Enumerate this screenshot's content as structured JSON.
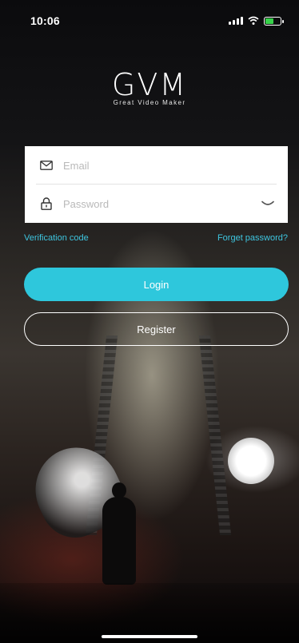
{
  "status_bar": {
    "time": "10:06"
  },
  "logo": {
    "title": "GVM",
    "tagline": "Great Video Maker"
  },
  "form": {
    "email_placeholder": "Email",
    "password_placeholder": "Password"
  },
  "links": {
    "verification": "Verification code",
    "forgot": "Forget password?"
  },
  "buttons": {
    "login": "Login",
    "register": "Register"
  },
  "colors": {
    "accent": "#2ec7dc",
    "link": "#3ec6e0",
    "battery": "#37d24a"
  },
  "icons": {
    "email": "envelope-icon",
    "password": "lock-icon",
    "toggle": "eye-closed-icon"
  }
}
